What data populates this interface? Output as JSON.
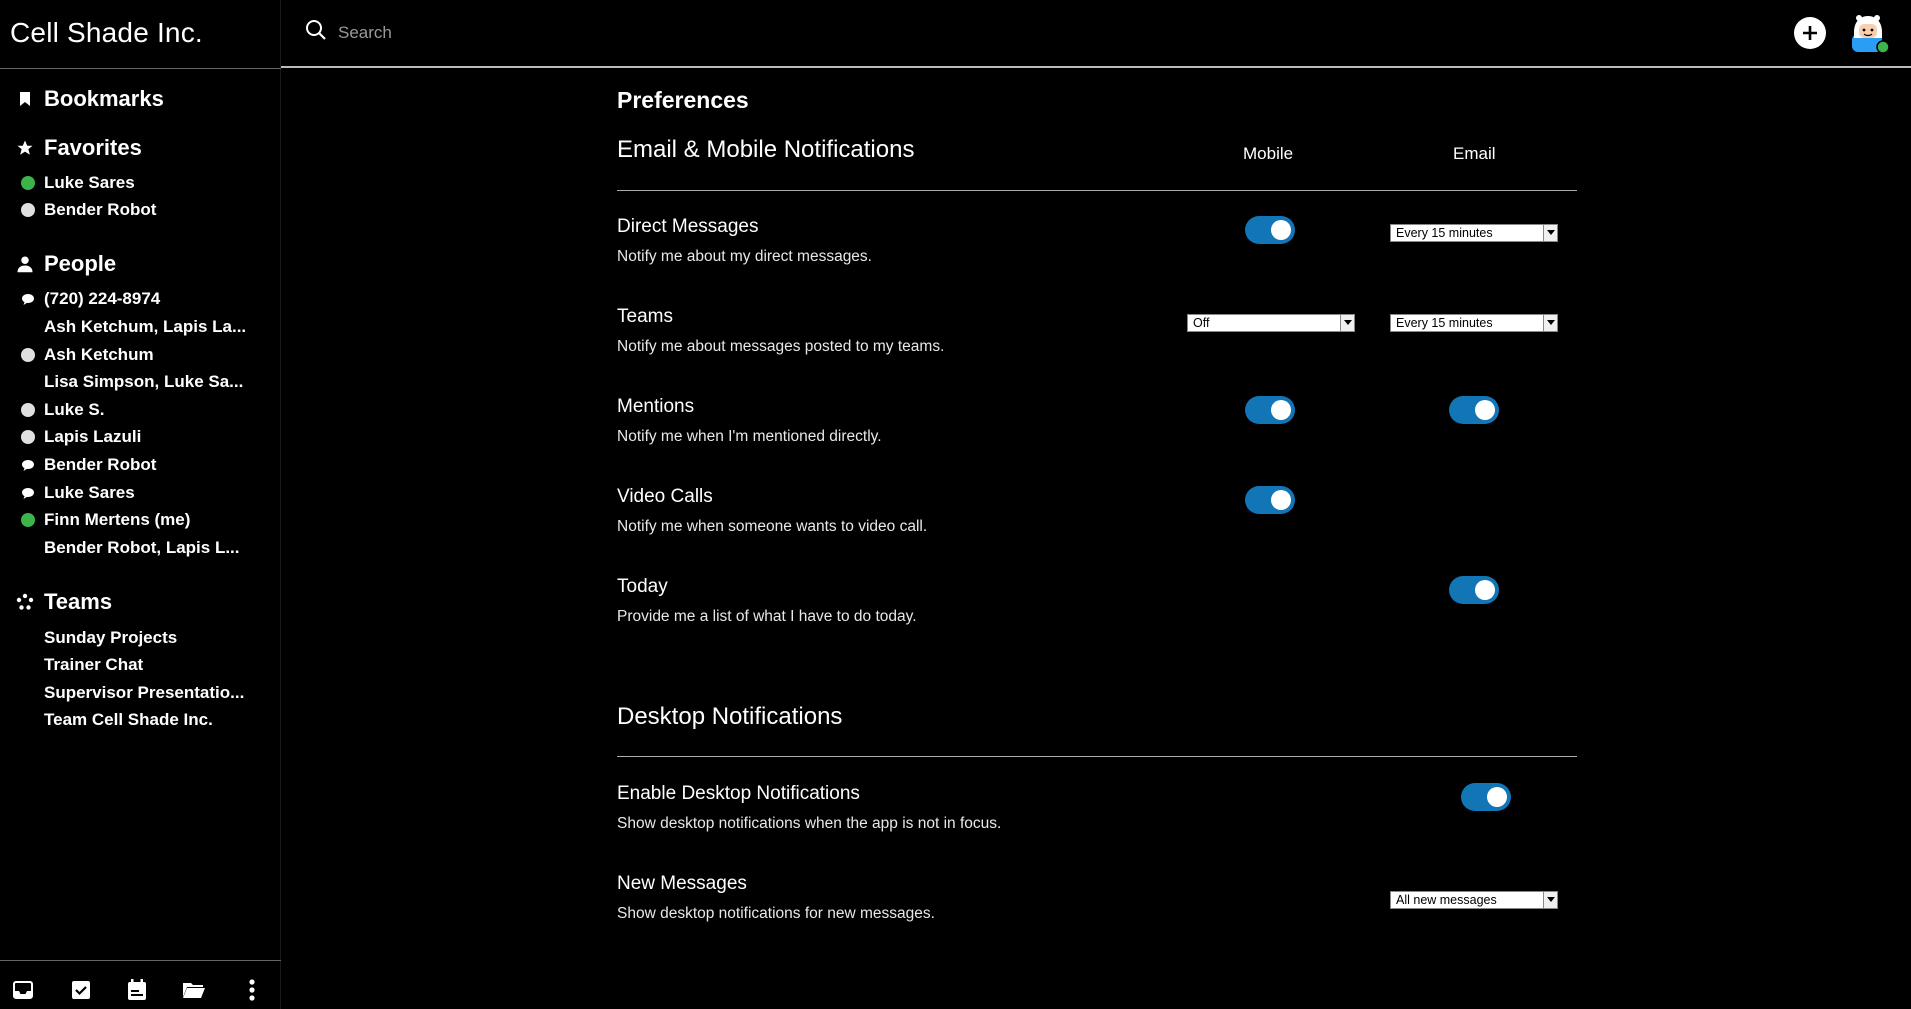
{
  "app": {
    "brand": "Cell Shade Inc."
  },
  "search": {
    "placeholder": "Search"
  },
  "sidebar": {
    "bookmarks_label": "Bookmarks",
    "favorites": {
      "label": "Favorites",
      "items": [
        {
          "label": "Luke Sares",
          "status": "online"
        },
        {
          "label": "Bender Robot",
          "status": "offline"
        }
      ]
    },
    "people": {
      "label": "People",
      "items": [
        {
          "label": "(720) 224-8974",
          "mark": "chat"
        },
        {
          "label": "Ash Ketchum, Lapis La...",
          "mark": "none"
        },
        {
          "label": "Ash Ketchum",
          "mark": "offline"
        },
        {
          "label": "Lisa Simpson, Luke Sa...",
          "mark": "none"
        },
        {
          "label": "Luke S.",
          "mark": "offline"
        },
        {
          "label": "Lapis Lazuli",
          "mark": "offline"
        },
        {
          "label": "Bender Robot",
          "mark": "chat"
        },
        {
          "label": "Luke Sares",
          "mark": "chat"
        },
        {
          "label": "Finn Mertens (me)",
          "mark": "online"
        },
        {
          "label": "Bender Robot, Lapis L...",
          "mark": "none"
        }
      ]
    },
    "teams": {
      "label": "Teams",
      "items": [
        {
          "label": "Sunday Projects"
        },
        {
          "label": "Trainer Chat"
        },
        {
          "label": "Supervisor Presentatio..."
        },
        {
          "label": "Team Cell Shade Inc."
        }
      ]
    },
    "bottom_icons": [
      "inbox-icon",
      "tasks-check-icon",
      "calendar-icon",
      "folder-icon",
      "more-vertical-icon"
    ]
  },
  "main": {
    "heading": "Preferences",
    "email_mobile": {
      "title": "Email & Mobile Notifications",
      "col_mobile": "Mobile",
      "col_email": "Email",
      "rows": [
        {
          "title": "Direct Messages",
          "desc": "Notify me about my direct messages.",
          "mobile": "on",
          "email": "Every 15 minutes"
        },
        {
          "title": "Teams",
          "desc": "Notify me about messages posted to my teams.",
          "mobile": "Off",
          "email": "Every 15 minutes"
        },
        {
          "title": "Mentions",
          "desc": "Notify me when I'm mentioned directly.",
          "mobile": "on",
          "email": "on"
        },
        {
          "title": "Video Calls",
          "desc": "Notify me when someone wants to video call.",
          "mobile": "on"
        },
        {
          "title": "Today",
          "desc": "Provide me a list of what I have to do today.",
          "email": "on"
        }
      ]
    },
    "desktop": {
      "title": "Desktop Notifications",
      "rows": [
        {
          "title": "Enable Desktop Notifications",
          "desc": "Show desktop notifications when the app is not in focus.",
          "value": "on"
        },
        {
          "title": "New Messages",
          "desc": "Show desktop notifications for new messages.",
          "value": "All new messages"
        }
      ]
    }
  },
  "colors": {
    "accent": "#1275b6",
    "online": "#3cb44b",
    "offline": "#e0e0e0",
    "background": "#000000"
  }
}
